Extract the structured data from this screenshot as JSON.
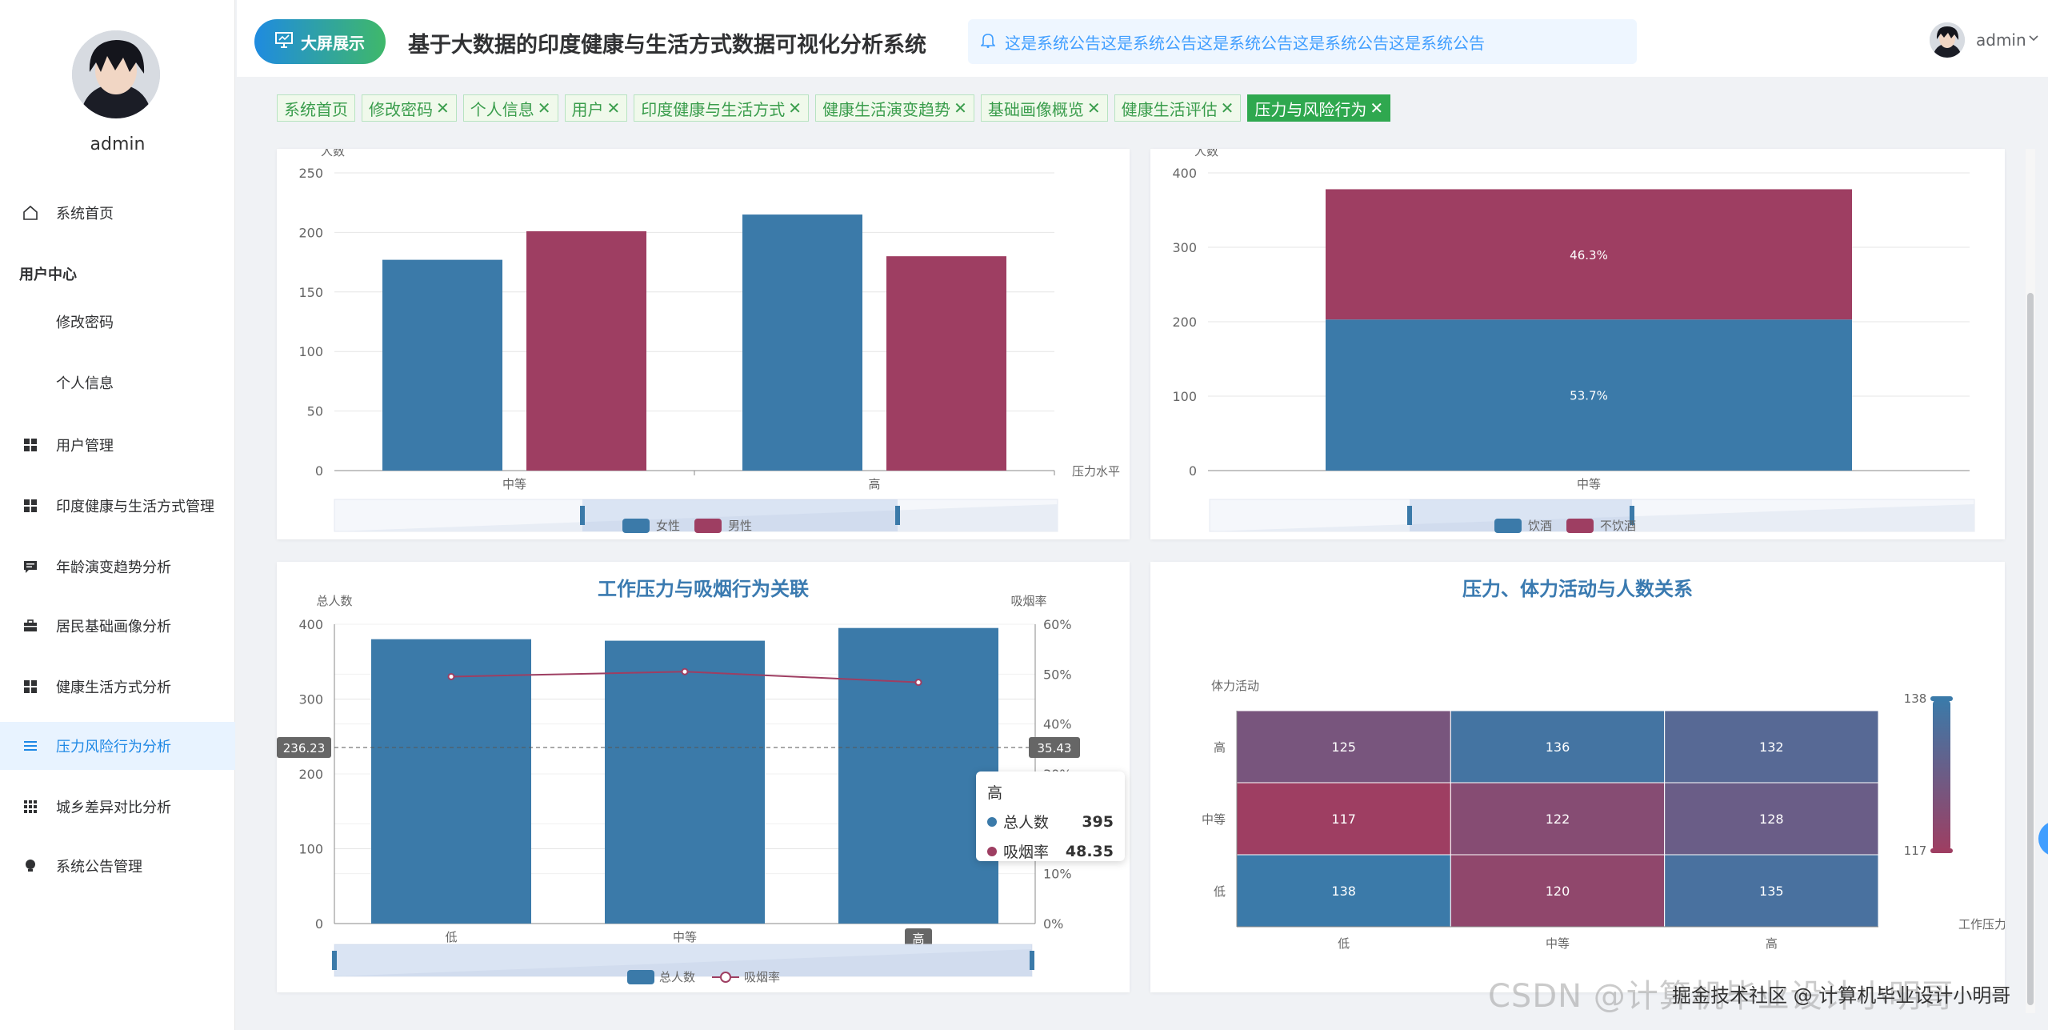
{
  "sidebar": {
    "username": "admin",
    "items": [
      {
        "label": "系统首页",
        "icon": "home-icon"
      },
      {
        "label": "用户中心",
        "icon": ""
      },
      {
        "label": "修改密码",
        "icon": ""
      },
      {
        "label": "个人信息",
        "icon": ""
      },
      {
        "label": "用户管理",
        "icon": "grid-icon"
      },
      {
        "label": "印度健康与生活方式管理",
        "icon": "grid-icon"
      },
      {
        "label": "年龄演变趋势分析",
        "icon": "chat-icon"
      },
      {
        "label": "居民基础画像分析",
        "icon": "briefcase-icon"
      },
      {
        "label": "健康生活方式分析",
        "icon": "grid-icon"
      },
      {
        "label": "压力风险行为分析",
        "icon": "list-icon"
      },
      {
        "label": "城乡差异对比分析",
        "icon": "grid-icon"
      },
      {
        "label": "系统公告管理",
        "icon": "bulb-icon"
      }
    ]
  },
  "header": {
    "big_screen_label": "大屏展示",
    "title": "基于大数据的印度健康与生活方式数据可视化分析系统",
    "notice": "这是系统公告这是系统公告这是系统公告这是系统公告这是系统公告",
    "username": "admin"
  },
  "tags": [
    {
      "label": "系统首页",
      "closable": false
    },
    {
      "label": "修改密码",
      "closable": true
    },
    {
      "label": "个人信息",
      "closable": true
    },
    {
      "label": "用户",
      "closable": true
    },
    {
      "label": "印度健康与生活方式",
      "closable": true
    },
    {
      "label": "健康生活演变趋势",
      "closable": true
    },
    {
      "label": "基础画像概览",
      "closable": true
    },
    {
      "label": "健康生活评估",
      "closable": true
    },
    {
      "label": "压力与风险行为",
      "closable": true,
      "active": true
    }
  ],
  "colors": {
    "blue": "#3b7aa9",
    "red": "#9e3e62",
    "accent": "#1e88e5",
    "green": "#2fa84f"
  },
  "chart_data": [
    {
      "type": "bar",
      "ylabel": "人数",
      "xlabel": "压力水平",
      "categories": [
        "中等",
        "高"
      ],
      "ylim": [
        0,
        250
      ],
      "yticks": [
        "0",
        "50",
        "100",
        "150",
        "200",
        "250"
      ],
      "series": [
        {
          "name": "女性",
          "values": [
            177,
            215
          ]
        },
        {
          "name": "男性",
          "values": [
            201,
            180
          ]
        }
      ],
      "legend": "bottom"
    },
    {
      "type": "bar",
      "stacked": true,
      "ylabel": "人数",
      "categories": [
        "中等"
      ],
      "ylim": [
        0,
        400
      ],
      "yticks": [
        "0",
        "100",
        "200",
        "300",
        "400"
      ],
      "series": [
        {
          "name": "饮酒",
          "values": [
            203
          ],
          "label": "53.7%"
        },
        {
          "name": "不饮酒",
          "values": [
            175
          ],
          "label": "46.3%"
        }
      ],
      "legend": "bottom"
    },
    {
      "type": "bar",
      "title": "工作压力与吸烟行为关联",
      "ylabel": "总人数",
      "y2label": "吸烟率",
      "categories": [
        "低",
        "中等",
        "高"
      ],
      "ylim": [
        0,
        400
      ],
      "yticks": [
        "0",
        "100",
        "200",
        "300",
        "400"
      ],
      "y2lim": [
        0,
        60
      ],
      "y2ticks": [
        "0%",
        "10%",
        "20%",
        "30%",
        "40%",
        "50%",
        "60%"
      ],
      "series": [
        {
          "name": "总人数",
          "type": "bar",
          "values": [
            380,
            378,
            395
          ]
        },
        {
          "name": "吸烟率",
          "type": "line",
          "values": [
            49.5,
            50.5,
            48.35
          ]
        }
      ],
      "crosshair": {
        "left": "236.23",
        "right": "35.43"
      },
      "highlighted_category": "高",
      "tooltip": {
        "title": "高",
        "rows": [
          {
            "name": "总人数",
            "value": "395"
          },
          {
            "name": "吸烟率",
            "value": "48.35"
          }
        ]
      },
      "legend": "bottom"
    },
    {
      "type": "heatmap",
      "title": "压力、体力活动与人数关系",
      "ylabel": "体力活动",
      "xlabel": "工作压力",
      "x": [
        "低",
        "中等",
        "高"
      ],
      "y": [
        "低",
        "中等",
        "高"
      ],
      "values": [
        [
          138,
          120,
          135
        ],
        [
          117,
          122,
          128
        ],
        [
          125,
          136,
          132
        ]
      ],
      "visual_map": {
        "min": "117",
        "max": "138"
      }
    }
  ],
  "watermark": {
    "faint": "CSDN @计算机毕业设计小明哥",
    "dark": "掘金技术社区 @ 计算机毕业设计小明哥"
  }
}
